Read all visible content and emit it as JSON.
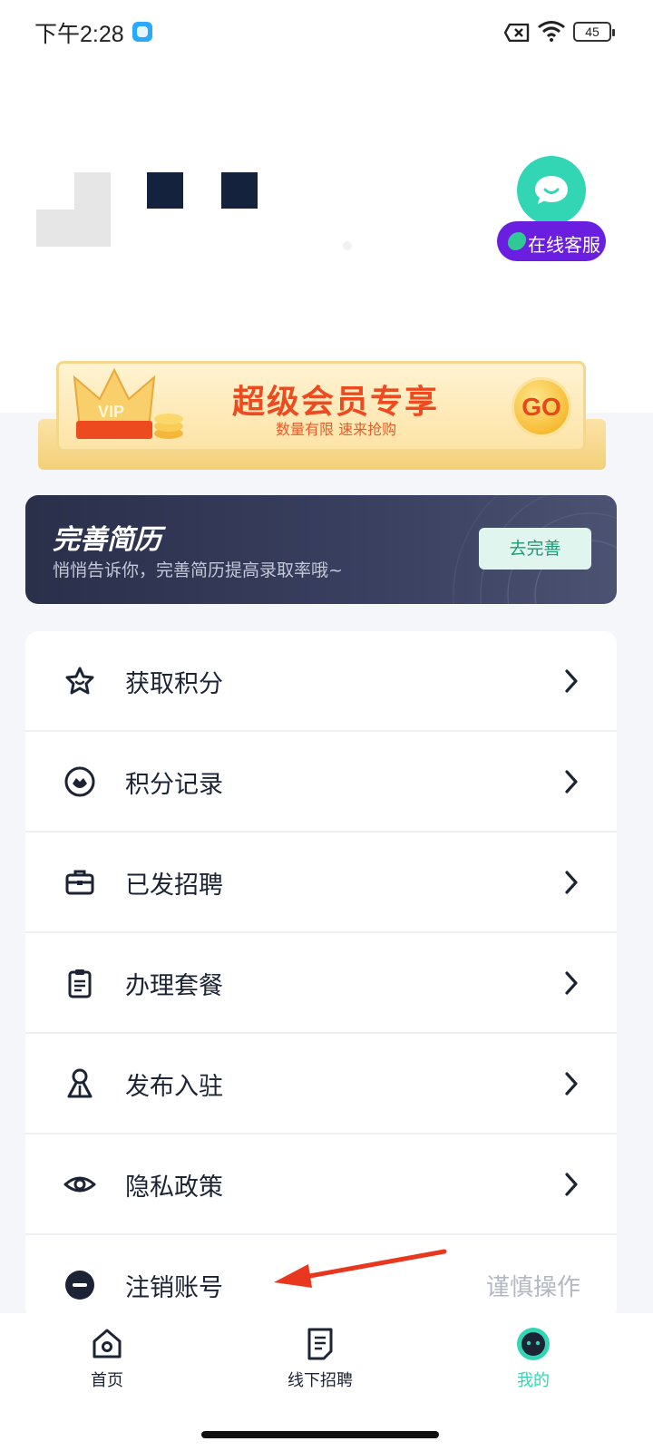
{
  "status_bar": {
    "time": "下午2:28",
    "battery": "45"
  },
  "customer_service": {
    "label": "在线客服"
  },
  "vip_banner": {
    "crown_text": "VIP",
    "title": "超级会员专享",
    "subtitle": "数量有限 速来抢购",
    "go_label": "GO"
  },
  "resume_card": {
    "title": "完善简历",
    "subtitle": "悄悄告诉你，完善简历提高录取率哦~",
    "button_label": "去完善"
  },
  "menu": {
    "items": [
      {
        "label": "获取积分",
        "icon": "star-icon"
      },
      {
        "label": "积分记录",
        "icon": "points-record-icon"
      },
      {
        "label": "已发招聘",
        "icon": "briefcase-icon"
      },
      {
        "label": "办理套餐",
        "icon": "clipboard-icon"
      },
      {
        "label": "发布入驻",
        "icon": "person-icon"
      },
      {
        "label": "隐私政策",
        "icon": "eye-icon"
      },
      {
        "label": "注销账号",
        "icon": "minus-circle-icon",
        "note": "谨慎操作"
      }
    ]
  },
  "bottom_nav": {
    "items": [
      {
        "label": "首页",
        "icon": "home-icon"
      },
      {
        "label": "线下招聘",
        "icon": "document-icon"
      },
      {
        "label": "我的",
        "icon": "profile-face-icon"
      }
    ]
  },
  "colors": {
    "accent_purple": "#6a1ee0",
    "service_green": "#33d6b4",
    "vip_orange": "#ee4a1f",
    "resume_dark": "#2a2f4a",
    "text_dark": "#1b2335",
    "annotation_red": "#e8361f"
  }
}
